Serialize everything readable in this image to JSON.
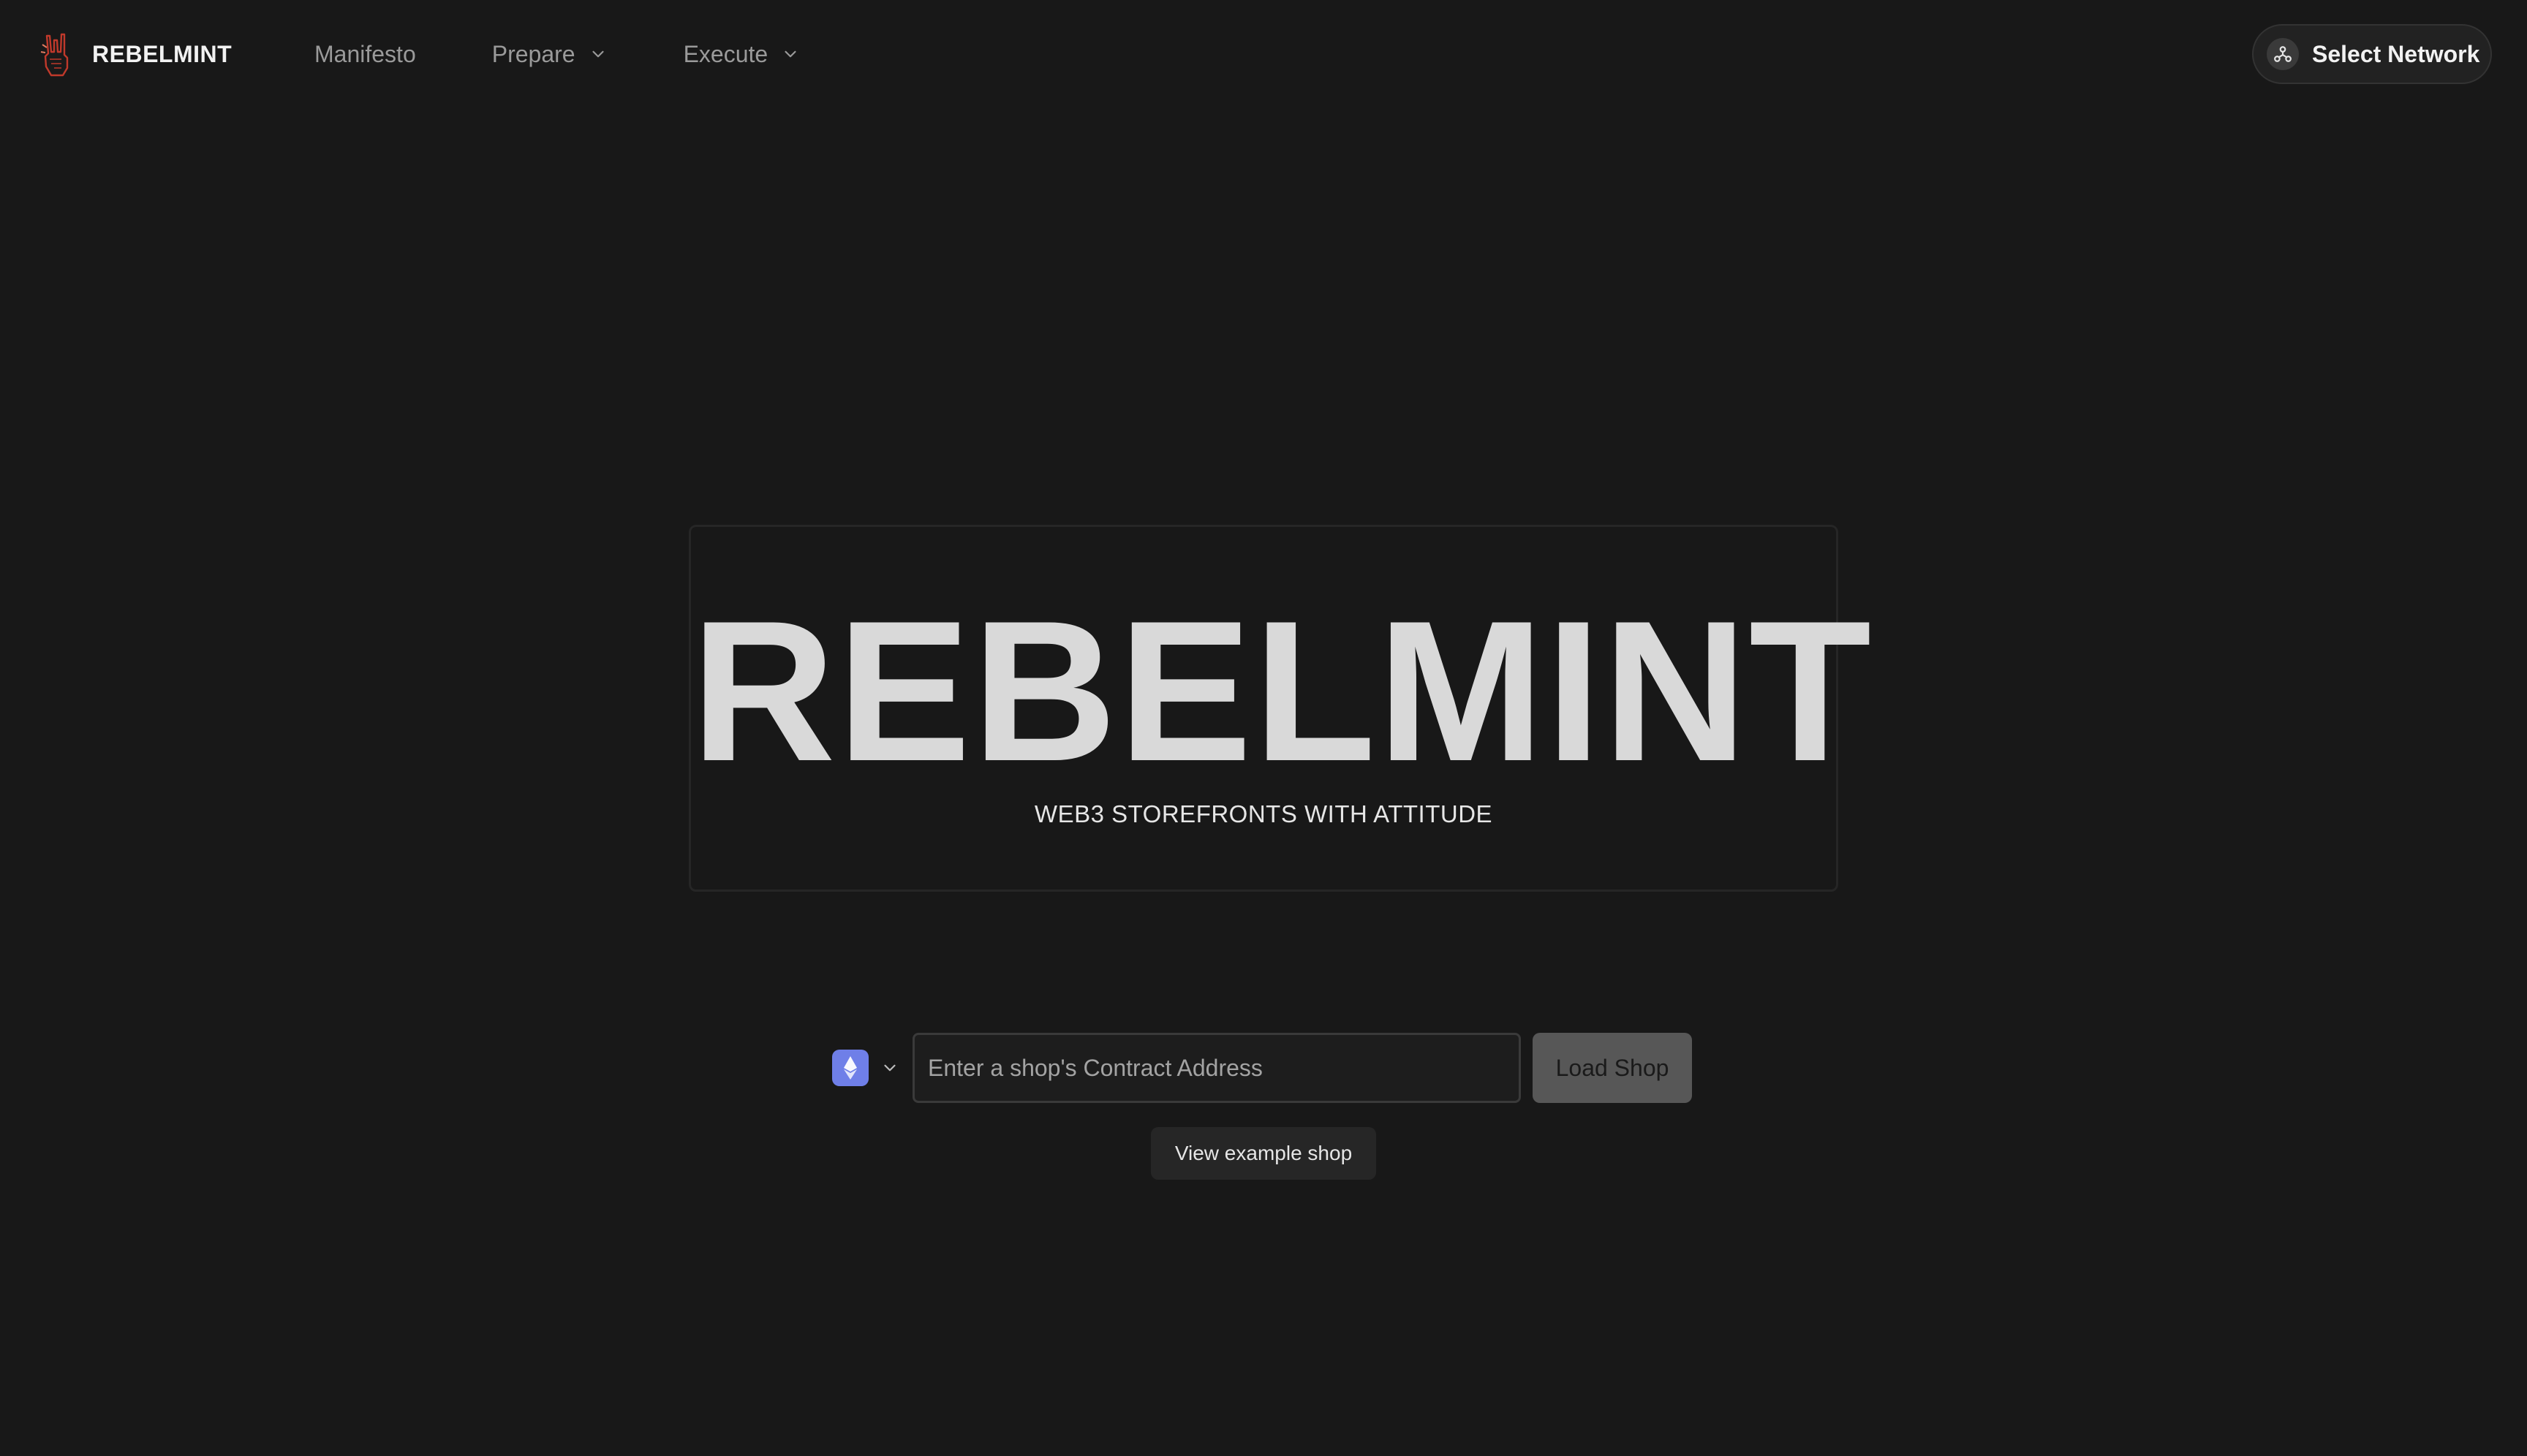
{
  "header": {
    "brand_name": "REBELMINT",
    "logo_icon": "rock-hand-icon",
    "nav": [
      {
        "label": "Manifesto",
        "has_dropdown": false
      },
      {
        "label": "Prepare",
        "has_dropdown": true
      },
      {
        "label": "Execute",
        "has_dropdown": true
      }
    ],
    "network_button": {
      "label": "Select Network",
      "icon": "network-nodes-icon"
    }
  },
  "hero": {
    "title": "REBELMINT",
    "subtitle": "WEB3 STOREFRONTS WITH ATTITUDE"
  },
  "shop_loader": {
    "chain_icon": "ethereum-icon",
    "chain_icon_color": "#6f7fe8",
    "address_placeholder": "Enter a shop's Contract Address",
    "address_value": "",
    "load_button_label": "Load Shop",
    "example_button_label": "View example shop"
  },
  "colors": {
    "background": "#181818",
    "hero_text": "#d9d9d9",
    "nav_text": "#9a9a9a",
    "logo_accent": "#c0392b"
  }
}
